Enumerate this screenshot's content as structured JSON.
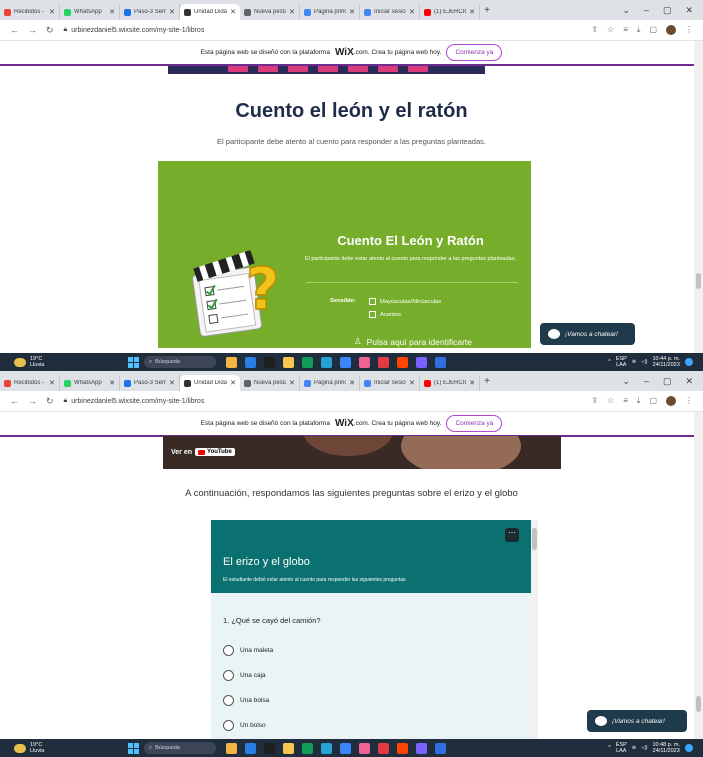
{
  "browser": {
    "tabs": [
      {
        "label": "Recibidos - ",
        "color": "#ea4335"
      },
      {
        "label": "WhatsApp",
        "color": "#25d366"
      },
      {
        "label": "Paso-3 Semi",
        "color": "#1a73e8"
      },
      {
        "label": "Unidad Didá",
        "color": "#333333"
      },
      {
        "label": "Nueva pesta",
        "color": "#5f6368"
      },
      {
        "label": "Página princ",
        "color": "#4285f4"
      },
      {
        "label": "Iniciar sesió",
        "color": "#4285f4"
      },
      {
        "label": "(1) EJERCICI",
        "color": "#ff0000"
      }
    ],
    "active_tab": 3,
    "new_tab": "+",
    "url": "urbinezdaniel5.wixsite.com/my-site-1/libros"
  },
  "wix_banner": {
    "before": "Esta página web se diseñó con la plataforma",
    "brand": "WiX",
    "after": ".com. Crea tu página web hoy.",
    "button": "Comienza ya"
  },
  "screen1": {
    "title": "Cuento el león y el ratón",
    "subtitle": "El participante debe atento al cuento para responder a las preguntas planteadas.",
    "card": {
      "title": "Cuento El León y Ratón",
      "desc": "El participante debe estar atento al cuento para responder a las preguntas planteadas.",
      "sensible_label": "Sensible:",
      "options": [
        "Mayúsculas/Minúsculas",
        "Acentos"
      ],
      "identify": "Pulsa aquí para identificarte"
    },
    "chat": "¡Vamos a chatear!",
    "time": "10:44 p. m.",
    "date": "24/11/2023"
  },
  "screen2": {
    "video_label": "Ver en",
    "video_brand": "YouTube",
    "intro": "A continuación, respondamos las siguientes preguntas sobre el  erizo y el globo",
    "form": {
      "menu": "⋯",
      "title": "El erizo y el globo",
      "desc": "El estudiante debió estar atento al cuento para responder las siguientes preguntas",
      "question": "1. ¿Qué se cayó del camión?",
      "options": [
        "Una maleta",
        "Una caja",
        "Una bolsa",
        "Un bolso"
      ]
    },
    "chat": "¡Vamos a chatear!",
    "time": "10:48 p. m.",
    "date": "24/11/2023"
  },
  "taskbar": {
    "temp": "19°C",
    "weather": "Lluvia",
    "search": "Búsqueda",
    "lang": "ESP",
    "region": "LAA",
    "app_colors": [
      "#f2b544",
      "#2a7de1",
      "#1e1e1e",
      "#f9c74f",
      "#0f9d58",
      "#28a0d8",
      "#3a86ff",
      "#f06292",
      "#e63946",
      "#ff4500",
      "#7b61ff",
      "#2f6fe0"
    ]
  }
}
